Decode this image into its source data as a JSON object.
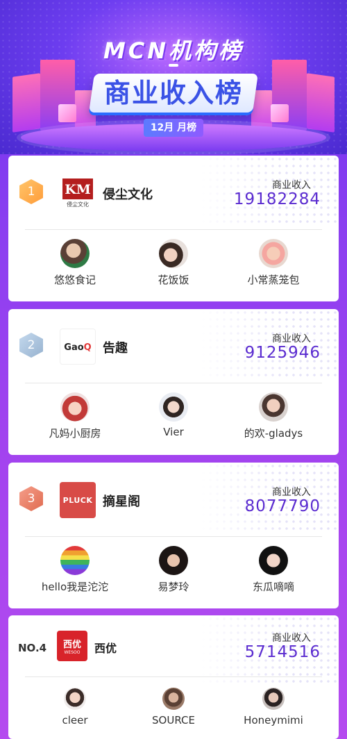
{
  "banner": {
    "title": "MCN机构榜",
    "subtitle": "商业收入榜",
    "month": "12月 月榜"
  },
  "revenue_label": "商业收入",
  "cards": [
    {
      "rank": "1",
      "org": "侵尘文化",
      "logo_text": "KM",
      "logo_sub": "侵尘文化",
      "revenue": "19182284",
      "kols": [
        "悠悠食记",
        "花饭饭",
        "小常蒸笼包"
      ]
    },
    {
      "rank": "2",
      "org": "告趣",
      "logo_text": "GaoQ",
      "revenue": "9125946",
      "kols": [
        "凡妈小厨房",
        "Vier",
        "的欢-gladys"
      ]
    },
    {
      "rank": "3",
      "org": "摘星阁",
      "logo_text": "PLUCK",
      "revenue": "8077790",
      "kols": [
        "hello我是沱沱",
        "易梦玲",
        "东瓜嘀嘀"
      ]
    },
    {
      "rank": "NO.4",
      "org": "西优",
      "logo_text": "西优",
      "logo_sub": "WESOO",
      "revenue": "5714516",
      "kols": [
        "cleer",
        "SOURCE",
        "Honeymimi"
      ]
    }
  ],
  "colors": {
    "accent": "#5a2bd0",
    "gold": "#ffb04a",
    "silver": "#a8c2de",
    "bronze": "#e87a60"
  }
}
